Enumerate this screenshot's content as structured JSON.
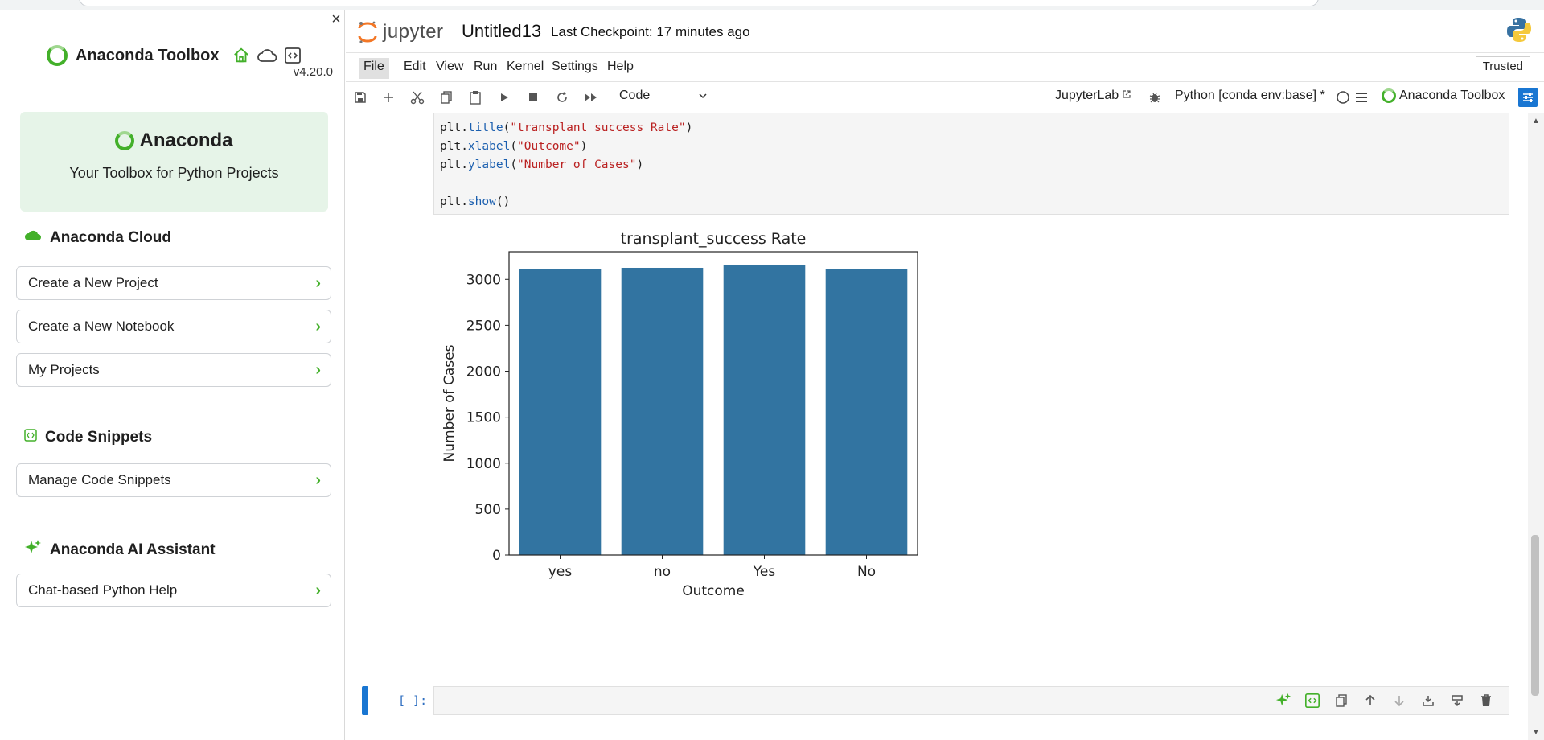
{
  "sidebar": {
    "title": "Anaconda Toolbox",
    "version": "v4.20.0",
    "hero": {
      "brand": "Anaconda",
      "tagline": "Your Toolbox for Python Projects"
    },
    "sections": [
      {
        "title": "Anaconda Cloud",
        "icon": "cloud-icon",
        "buttons": [
          "Create a New Project",
          "Create a New Notebook",
          "My Projects"
        ]
      },
      {
        "title": "Code Snippets",
        "icon": "code-snippet-icon",
        "buttons": [
          "Manage Code Snippets"
        ]
      },
      {
        "title": "Anaconda AI Assistant",
        "icon": "sparkle-icon",
        "buttons": [
          "Chat-based Python Help"
        ]
      }
    ]
  },
  "header": {
    "logo_text": "jupyter",
    "notebook_name": "Untitled13",
    "checkpoint": "Last Checkpoint: 17 minutes ago"
  },
  "menu": [
    "File",
    "Edit",
    "View",
    "Run",
    "Kernel",
    "Settings",
    "Help"
  ],
  "trusted": "Trusted",
  "toolbar": {
    "cell_type": "Code",
    "jupyterlab": "JupyterLab",
    "kernel": "Python [conda env:base] *",
    "toolbox": "Anaconda Toolbox"
  },
  "code": {
    "lines": [
      {
        "fn": "plt.",
        "call": "title",
        "arg": "\"transplant_success Rate\""
      },
      {
        "fn": "plt.",
        "call": "xlabel",
        "arg": "\"Outcome\""
      },
      {
        "fn": "plt.",
        "call": "ylabel",
        "arg": "\"Number of Cases\""
      },
      {
        "fn": "plt.",
        "call": "show",
        "arg": ""
      }
    ]
  },
  "empty_prompt": "[ ]:",
  "colors": {
    "accent_green": "#43b02a",
    "bar_blue": "#3274a1",
    "jupyter_blue": "#1976d2"
  },
  "chart_data": {
    "type": "bar",
    "title": "transplant_success Rate",
    "xlabel": "Outcome",
    "ylabel": "Number of Cases",
    "categories": [
      "yes",
      "no",
      "Yes",
      "No"
    ],
    "values": [
      3110,
      3125,
      3160,
      3115
    ],
    "ylim": [
      0,
      3300
    ],
    "yticks": [
      0,
      500,
      1000,
      1500,
      2000,
      2500,
      3000
    ],
    "grid": false
  }
}
